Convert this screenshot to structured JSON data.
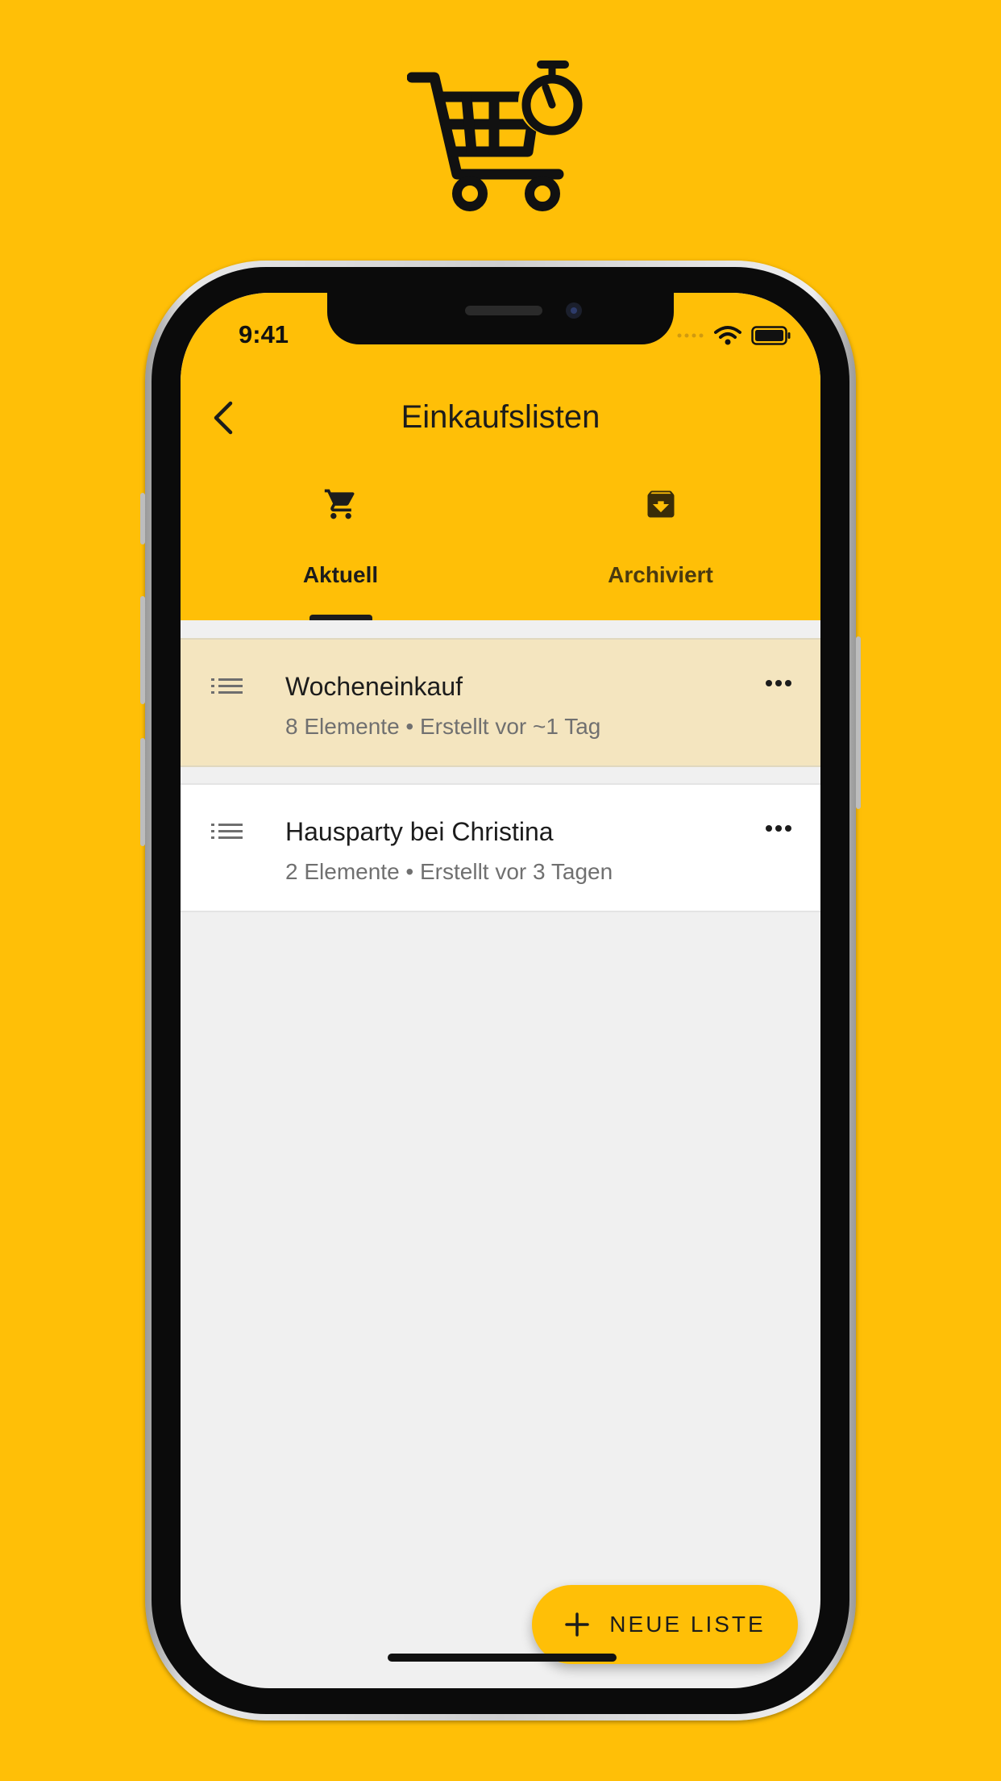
{
  "status_bar": {
    "time": "9:41"
  },
  "header": {
    "title": "Einkaufslisten"
  },
  "tabs": [
    {
      "label": "Aktuell",
      "icon": "cart-icon",
      "active": true
    },
    {
      "label": "Archiviert",
      "icon": "archive-icon",
      "active": false
    }
  ],
  "lists": [
    {
      "title": "Wocheneinkauf",
      "subtitle": "8 Elemente • Erstellt vor ~1 Tag",
      "highlighted": true
    },
    {
      "title": "Hausparty bei Christina",
      "subtitle": "2 Elemente • Erstellt vor 3 Tagen",
      "highlighted": false
    }
  ],
  "fab": {
    "label": "NEUE LISTE"
  },
  "colors": {
    "accent": "#FFBF07",
    "highlight_row": "#F4E5BF",
    "list_background": "#F0F0F0"
  }
}
